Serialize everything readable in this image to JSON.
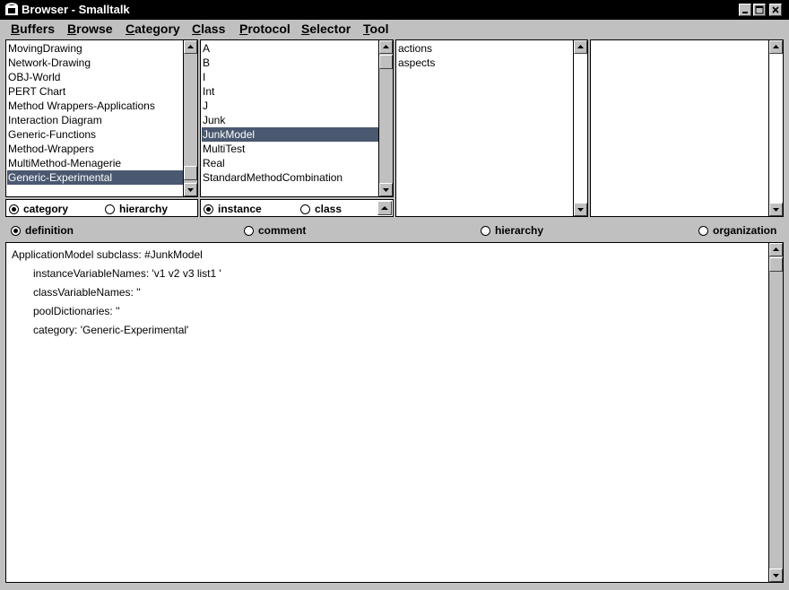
{
  "window": {
    "title": "Browser - Smalltalk"
  },
  "menu": [
    {
      "first": "B",
      "rest": "uffers"
    },
    {
      "first": "B",
      "rest": "rowse"
    },
    {
      "first": "C",
      "rest": "ategory"
    },
    {
      "first": "C",
      "rest": "lass"
    },
    {
      "first": "P",
      "rest": "rotocol"
    },
    {
      "first": "S",
      "rest": "elector"
    },
    {
      "first": "T",
      "rest": "ool"
    }
  ],
  "categories": {
    "items": [
      "MovingDrawing",
      "Network-Drawing",
      "OBJ-World",
      "PERT Chart",
      "Method Wrappers-Applications",
      "Interaction Diagram",
      "Generic-Functions",
      "Method-Wrappers",
      "MultiMethod-Menagerie",
      "Generic-Experimental"
    ],
    "selected_index": 9,
    "radio": {
      "category": "category",
      "hierarchy": "hierarchy",
      "selected": "category"
    }
  },
  "classes": {
    "items": [
      "A",
      "B",
      "I",
      "Int",
      "J",
      "Junk",
      "JunkModel",
      "MultiTest",
      "Real",
      "StandardMethodCombination"
    ],
    "selected_index": 6,
    "radio": {
      "instance": "instance",
      "class": "class",
      "selected": "instance"
    }
  },
  "protocols": {
    "items": [
      "actions",
      "aspects"
    ]
  },
  "selectors": {
    "items": []
  },
  "view_modes": {
    "definition": "definition",
    "comment": "comment",
    "hierarchy": "hierarchy",
    "organization": "organization",
    "selected": "definition"
  },
  "code": {
    "line1": "ApplicationModel subclass: #JunkModel",
    "line2": "instanceVariableNames: 'v1 v2 v3 list1 '",
    "line3": "classVariableNames: ''",
    "line4": "poolDictionaries: ''",
    "line5": "category: 'Generic-Experimental'"
  },
  "icons": {
    "window": "smalltalk-app-icon",
    "minimize": "minimize-icon",
    "maximize": "maximize-icon",
    "close": "close-icon"
  }
}
